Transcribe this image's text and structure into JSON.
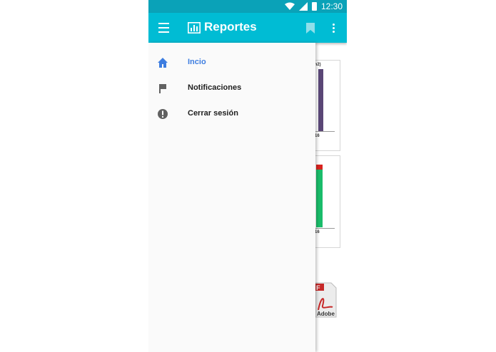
{
  "status_bar": {
    "time": "12:30"
  },
  "app_bar": {
    "title": "Reportes"
  },
  "drawer": {
    "items": [
      {
        "label": "Incio",
        "icon": "home-icon",
        "active": true
      },
      {
        "label": "Notificaciones",
        "icon": "flag-icon",
        "active": false
      },
      {
        "label": "Cerrar sesión",
        "icon": "alert-circle-icon",
        "active": false
      }
    ]
  },
  "background_cards": [
    {
      "visible_title_fragment": "m2)",
      "tick_label": "16",
      "bar_color": "#5a4676"
    },
    {
      "tick_label": "16",
      "bar_colors": [
        "#d9231f",
        "#1abc6a"
      ]
    }
  ],
  "pdf": {
    "label": "Adobe",
    "letter": "F"
  },
  "colors": {
    "appbar": "#00bcd4",
    "statusbar": "#0aa2b8",
    "active": "#3d7de0"
  }
}
